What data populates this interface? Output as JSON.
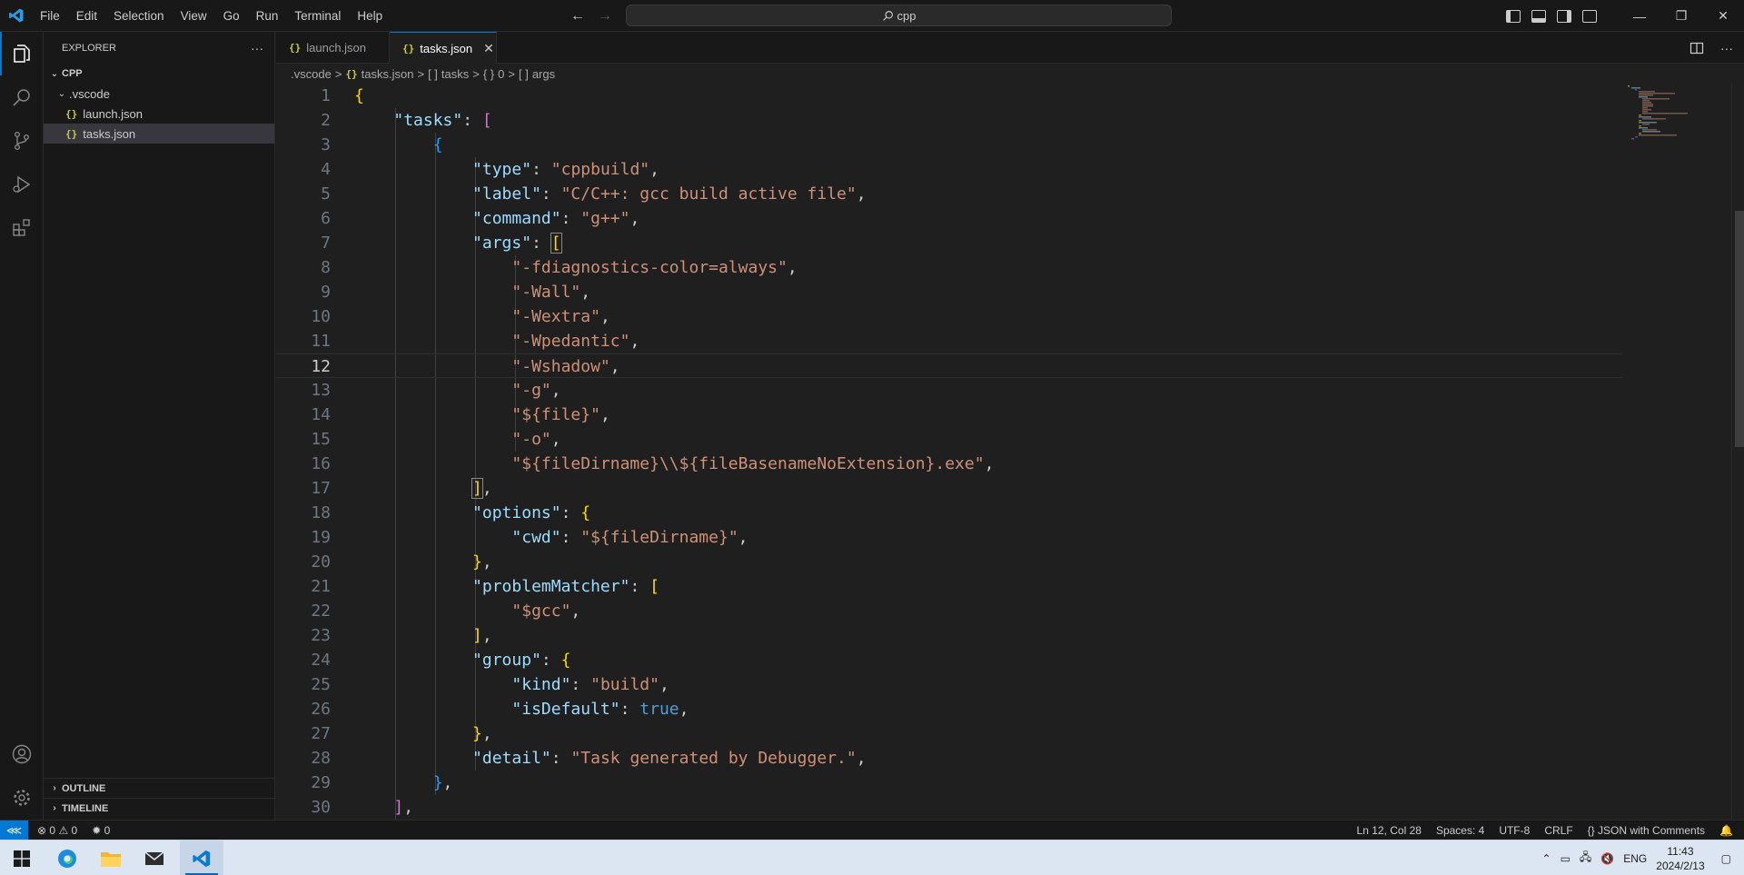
{
  "titlebar": {
    "menu": [
      "File",
      "Edit",
      "Selection",
      "View",
      "Go",
      "Run",
      "Terminal",
      "Help"
    ],
    "search_text": "cpp"
  },
  "sidebar": {
    "title": "EXPLORER",
    "more": "···",
    "root": "CPP",
    "folder": ".vscode",
    "files": [
      "launch.json",
      "tasks.json"
    ],
    "outline": "OUTLINE",
    "timeline": "TIMELINE"
  },
  "tabs": [
    {
      "label": "launch.json",
      "active": false
    },
    {
      "label": "tasks.json",
      "active": true
    }
  ],
  "breadcrumb": {
    "folder": ".vscode",
    "file": "tasks.json",
    "p1": "tasks",
    "p2": "0",
    "p3": "args"
  },
  "editor": {
    "current_line": 12,
    "line_numbers": [
      "1",
      "2",
      "3",
      "4",
      "5",
      "6",
      "7",
      "8",
      "9",
      "10",
      "11",
      "12",
      "13",
      "14",
      "15",
      "16",
      "17",
      "18",
      "19",
      "20",
      "21",
      "22",
      "23",
      "24",
      "25",
      "26",
      "27",
      "28",
      "29",
      "30"
    ],
    "lines": [
      [
        [
          "b1",
          "{"
        ]
      ],
      [
        [
          "ind1",
          "    "
        ],
        [
          "key",
          "\"tasks\""
        ],
        [
          "p",
          ": "
        ],
        [
          "b2",
          "["
        ]
      ],
      [
        [
          "ind2",
          "        "
        ],
        [
          "b3",
          "{"
        ]
      ],
      [
        [
          "ind3",
          "            "
        ],
        [
          "key",
          "\"type\""
        ],
        [
          "p",
          ": "
        ],
        [
          "str",
          "\"cppbuild\""
        ],
        [
          "p",
          ","
        ]
      ],
      [
        [
          "ind3",
          "            "
        ],
        [
          "key",
          "\"label\""
        ],
        [
          "p",
          ": "
        ],
        [
          "str",
          "\"C/C++: gcc build active file\""
        ],
        [
          "p",
          ","
        ]
      ],
      [
        [
          "ind3",
          "            "
        ],
        [
          "key",
          "\"command\""
        ],
        [
          "p",
          ": "
        ],
        [
          "str",
          "\"g++\""
        ],
        [
          "p",
          ","
        ]
      ],
      [
        [
          "ind3",
          "            "
        ],
        [
          "key",
          "\"args\""
        ],
        [
          "p",
          ": "
        ],
        [
          "b1h",
          "["
        ]
      ],
      [
        [
          "ind4",
          "                "
        ],
        [
          "str",
          "\"-fdiagnostics-color=always\""
        ],
        [
          "p",
          ","
        ]
      ],
      [
        [
          "ind4",
          "                "
        ],
        [
          "str",
          "\"-Wall\""
        ],
        [
          "p",
          ","
        ]
      ],
      [
        [
          "ind4",
          "                "
        ],
        [
          "str",
          "\"-Wextra\""
        ],
        [
          "p",
          ","
        ]
      ],
      [
        [
          "ind4",
          "                "
        ],
        [
          "str",
          "\"-Wpedantic\""
        ],
        [
          "p",
          ","
        ]
      ],
      [
        [
          "ind4",
          "                "
        ],
        [
          "str",
          "\"-Wshadow\""
        ],
        [
          "p",
          ","
        ]
      ],
      [
        [
          "ind4",
          "                "
        ],
        [
          "str",
          "\"-g\""
        ],
        [
          "p",
          ","
        ]
      ],
      [
        [
          "ind4",
          "                "
        ],
        [
          "str",
          "\"${file}\""
        ],
        [
          "p",
          ","
        ]
      ],
      [
        [
          "ind4",
          "                "
        ],
        [
          "str",
          "\"-o\""
        ],
        [
          "p",
          ","
        ]
      ],
      [
        [
          "ind4",
          "                "
        ],
        [
          "str",
          "\"${fileDirname}\\\\${fileBasenameNoExtension}.exe\""
        ],
        [
          "p",
          ","
        ]
      ],
      [
        [
          "ind3",
          "            "
        ],
        [
          "b1h",
          "]"
        ],
        [
          "p",
          ","
        ]
      ],
      [
        [
          "ind3",
          "            "
        ],
        [
          "key",
          "\"options\""
        ],
        [
          "p",
          ": "
        ],
        [
          "b1",
          "{"
        ]
      ],
      [
        [
          "ind4",
          "                "
        ],
        [
          "key",
          "\"cwd\""
        ],
        [
          "p",
          ": "
        ],
        [
          "str",
          "\"${fileDirname}\""
        ],
        [
          "p",
          ","
        ]
      ],
      [
        [
          "ind3",
          "            "
        ],
        [
          "b1",
          "}"
        ],
        [
          "p",
          ","
        ]
      ],
      [
        [
          "ind3",
          "            "
        ],
        [
          "key",
          "\"problemMatcher\""
        ],
        [
          "p",
          ": "
        ],
        [
          "b1",
          "["
        ]
      ],
      [
        [
          "ind4",
          "                "
        ],
        [
          "str",
          "\"$gcc\""
        ],
        [
          "p",
          ","
        ]
      ],
      [
        [
          "ind3",
          "            "
        ],
        [
          "b1",
          "]"
        ],
        [
          "p",
          ","
        ]
      ],
      [
        [
          "ind3",
          "            "
        ],
        [
          "key",
          "\"group\""
        ],
        [
          "p",
          ": "
        ],
        [
          "b1",
          "{"
        ]
      ],
      [
        [
          "ind4",
          "                "
        ],
        [
          "key",
          "\"kind\""
        ],
        [
          "p",
          ": "
        ],
        [
          "str",
          "\"build\""
        ],
        [
          "p",
          ","
        ]
      ],
      [
        [
          "ind4",
          "                "
        ],
        [
          "key",
          "\"isDefault\""
        ],
        [
          "p",
          ": "
        ],
        [
          "kw",
          "true"
        ],
        [
          "p",
          ","
        ]
      ],
      [
        [
          "ind3",
          "            "
        ],
        [
          "b1",
          "}"
        ],
        [
          "p",
          ","
        ]
      ],
      [
        [
          "ind3",
          "            "
        ],
        [
          "key",
          "\"detail\""
        ],
        [
          "p",
          ": "
        ],
        [
          "str",
          "\"Task generated by Debugger.\""
        ],
        [
          "p",
          ","
        ]
      ],
      [
        [
          "ind2",
          "        "
        ],
        [
          "b3",
          "}"
        ],
        [
          "p",
          ","
        ]
      ],
      [
        [
          "ind1",
          "    "
        ],
        [
          "b2",
          "]"
        ],
        [
          "p",
          ","
        ]
      ]
    ]
  },
  "statusbar": {
    "errors": "0",
    "warnings": "0",
    "ports": "0",
    "position": "Ln 12, Col 28",
    "spaces": "Spaces: 4",
    "encoding": "UTF-8",
    "eol": "CRLF",
    "language": "JSON with Comments"
  },
  "taskbar": {
    "lang": "ENG",
    "time": "11:43",
    "date": "2024/2/13"
  },
  "colors": {
    "accent": "#0078d4",
    "key": "#9cdcfe",
    "string": "#ce9178",
    "keyword": "#569cd6",
    "bracket1": "#ffd700",
    "bracket2": "#da70d6",
    "bracket3": "#179fff"
  }
}
